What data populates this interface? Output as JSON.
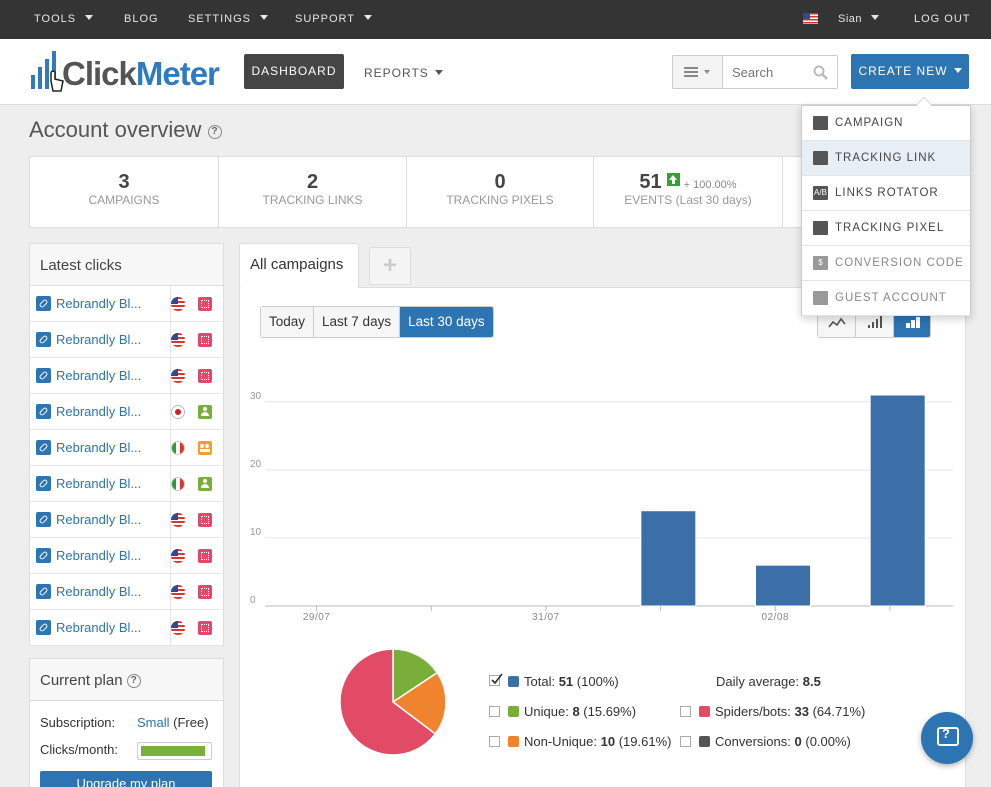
{
  "topbar": {
    "tools": "TOOLS",
    "blog": "BLOG",
    "settings": "SETTINGS",
    "support": "SUPPORT",
    "user": "Sian",
    "logout": "LOG OUT"
  },
  "header": {
    "logo_click": "Click",
    "logo_meter": "Meter",
    "dashboard": "DASHBOARD",
    "reports": "REPORTS",
    "search_placeholder": "Search",
    "create_new": "CREATE NEW"
  },
  "create_menu": {
    "items": [
      {
        "label": "CAMPAIGN",
        "icon": "folder-icon"
      },
      {
        "label": "TRACKING LINK",
        "icon": "link-icon"
      },
      {
        "label": "LINKS ROTATOR",
        "icon": "ab-icon",
        "glyph": "A/B"
      },
      {
        "label": "TRACKING PIXEL",
        "icon": "image-icon"
      },
      {
        "label": "CONVERSION CODE",
        "icon": "dollar-icon",
        "glyph": "$"
      },
      {
        "label": "GUEST ACCOUNT",
        "icon": "user-icon"
      }
    ]
  },
  "page": {
    "title": "Account overview",
    "help": "?"
  },
  "stats": [
    {
      "value": "3",
      "label": "CAMPAIGNS"
    },
    {
      "value": "2",
      "label": "TRACKING LINKS"
    },
    {
      "value": "0",
      "label": "TRACKING PIXELS"
    },
    {
      "value": "51",
      "change": "+ 100.00%",
      "label": "EVENTS",
      "sub": "(Last 30 days)"
    }
  ],
  "latest_clicks": {
    "title": "Latest clicks",
    "rows": [
      {
        "name": "Rebrandly Bl...",
        "flag": "us",
        "type": "bot"
      },
      {
        "name": "Rebrandly Bl...",
        "flag": "us",
        "type": "bot"
      },
      {
        "name": "Rebrandly Bl...",
        "flag": "us",
        "type": "bot"
      },
      {
        "name": "Rebrandly Bl...",
        "flag": "jp",
        "type": "user"
      },
      {
        "name": "Rebrandly Bl...",
        "flag": "it",
        "type": "group"
      },
      {
        "name": "Rebrandly Bl...",
        "flag": "it",
        "type": "user"
      },
      {
        "name": "Rebrandly Bl...",
        "flag": "us",
        "type": "bot"
      },
      {
        "name": "Rebrandly Bl...",
        "flag": "us",
        "type": "bot"
      },
      {
        "name": "Rebrandly Bl...",
        "flag": "us",
        "type": "bot"
      },
      {
        "name": "Rebrandly Bl...",
        "flag": "us",
        "type": "bot"
      }
    ]
  },
  "current_plan": {
    "title": "Current plan",
    "help": "?",
    "subscription_label": "Subscription:",
    "subscription_value": "Small",
    "subscription_tier": "(Free)",
    "clicks_label": "Clicks/month:",
    "clicks_usage_fraction": 0.95,
    "upgrade": "Upgrade my plan"
  },
  "main": {
    "tab": "All campaigns",
    "add_tab": "+",
    "ranges": [
      "Today",
      "Last 7 days",
      "Last 30 days"
    ],
    "active_range": "Last 30 days"
  },
  "chart_data": {
    "type": "bar",
    "x": [
      "29/07",
      "30/07",
      "31/07",
      "01/08",
      "02/08",
      "03/08"
    ],
    "xticks_labeled": [
      "29/07",
      "31/07",
      "02/08"
    ],
    "values": [
      0,
      0,
      0,
      14,
      6,
      31
    ],
    "ylim": [
      0,
      30
    ],
    "yticks": [
      0,
      10,
      20,
      30
    ],
    "grid": true,
    "color": "#3c6fa8"
  },
  "pie_data": {
    "slices": [
      {
        "name": "Unique",
        "value": 8,
        "color": "#7aae3a"
      },
      {
        "name": "Non-Unique",
        "value": 10,
        "color": "#f0832e"
      },
      {
        "name": "Spiders/bots",
        "value": 33,
        "color": "#e24b65"
      }
    ]
  },
  "legend": {
    "total": {
      "label": "Total:",
      "value": "51",
      "pct": "(100%)",
      "color": "#3c6fa8"
    },
    "unique": {
      "label": "Unique:",
      "value": "8",
      "pct": "(15.69%)",
      "color": "#7aae3a"
    },
    "nonunique": {
      "label": "Non-Unique:",
      "value": "10",
      "pct": "(19.61%)",
      "color": "#f0832e"
    },
    "daily": {
      "label": "Daily average:",
      "value": "8.5"
    },
    "bots": {
      "label": "Spiders/bots:",
      "value": "33",
      "pct": "(64.71%)",
      "color": "#e24b65"
    },
    "conversions": {
      "label": "Conversions:",
      "value": "0",
      "pct": "(0.00%)",
      "color": "#555555"
    }
  }
}
